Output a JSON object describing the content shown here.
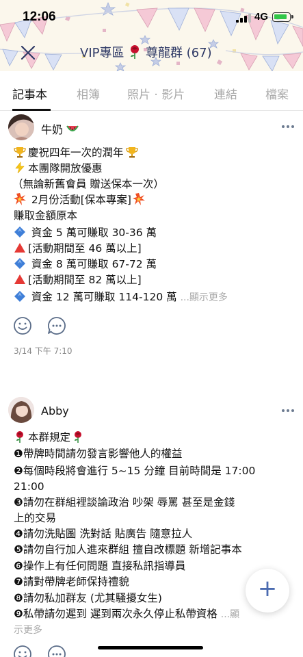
{
  "status_bar": {
    "time": "12:06",
    "network": "4G"
  },
  "header": {
    "title_prefix": "VIP專區",
    "title_suffix": "尊龍群 (67)",
    "close_icon": "close-icon",
    "colors": {
      "title": "#2f3a66",
      "background": "#fbf7ec"
    }
  },
  "tabs": [
    {
      "label": "記事本",
      "active": true
    },
    {
      "label": "相簿"
    },
    {
      "label": "照片 · 影片"
    },
    {
      "label": "連結"
    },
    {
      "label": "檔案"
    }
  ],
  "posts": [
    {
      "author": "牛奶",
      "author_emoji": "watermelon-icon",
      "lines": [
        {
          "icon": "trophy-icon",
          "text": "慶祝四年一次的潤年",
          "icon_after": "trophy-icon"
        },
        {
          "icon": "lightning-icon",
          "text": "本團隊開放優惠"
        },
        {
          "text": "（無論新舊會員 贈送保本一次）"
        },
        {
          "icon": "collision-icon",
          "text": " 2月份活動[保本專案]",
          "icon_after": "collision-icon"
        },
        {
          "text": "賺取金額原本"
        },
        {
          "icon": "blue-diamond-icon",
          "text": " 資金 5 萬可賺取 30-36 萬"
        },
        {
          "icon": "red-triangle-icon",
          "text": "[活動期間至 46 萬以上]"
        },
        {
          "icon": "blue-diamond-icon",
          "text": " 資金 8 萬可賺取 67-72 萬"
        },
        {
          "icon": "red-triangle-icon",
          "text": "[活動期間至 82 萬以上]"
        },
        {
          "icon": "blue-diamond-icon",
          "text": " 資金 12 萬可賺取 114-120 萬",
          "more": "...顯示更多"
        }
      ],
      "date": "3/14 下午 7:10"
    },
    {
      "author": "Abby",
      "lines": [
        {
          "icon": "rose-icon",
          "text": "本群規定",
          "icon_after": "rose-icon"
        },
        {
          "text": "❶帶牌時間請勿發言影響他人的權益"
        },
        {
          "text": "❷每個時段將會進行 5~15 分鐘 目前時間是 17:00"
        },
        {
          "text": "21:00"
        },
        {
          "text": "❸請勿在群組裡談論政治 吵架 辱罵 甚至是金錢"
        },
        {
          "text": "上的交易"
        },
        {
          "text": "❹請勿洗貼圖 洗對話 貼廣告 隨意拉人"
        },
        {
          "text": "❺請勿自行加人進來群組 擅自改標題 新增記事本"
        },
        {
          "text": "❻操作上有任何問題 直接私訊指導員"
        },
        {
          "text": "❼請對帶牌老師保持禮貌"
        },
        {
          "text": "❽請勿私加群友 (尤其騷擾女生)"
        },
        {
          "text": "❾私帶請勿遲到 遲到兩次永久停止私帶資格",
          "more": "...顯"
        },
        {
          "text": "",
          "more": "示更多"
        }
      ]
    }
  ],
  "fab": {
    "label": "+",
    "icon": "plus-icon"
  }
}
